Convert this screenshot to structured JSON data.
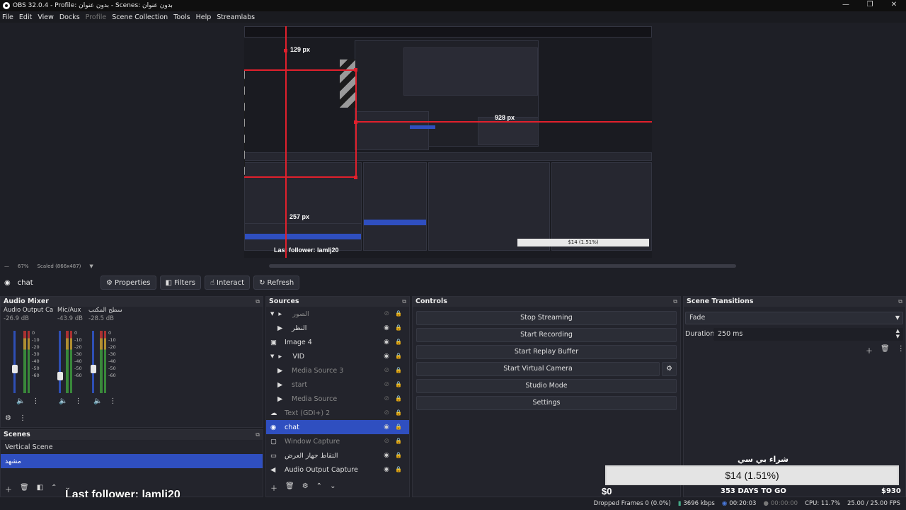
{
  "window": {
    "title": "OBS 32.0.4 - Profile: بدون عنوان - Scenes: بدون عنوان",
    "controls": [
      "—",
      "❐",
      "✕"
    ]
  },
  "menu": [
    "File",
    "Edit",
    "View",
    "Docks",
    "Profile",
    "Scene Collection",
    "Tools",
    "Help",
    "Streamlabs"
  ],
  "preview": {
    "zoom": "67%",
    "scaled": "Scaled (866x487)",
    "measurements": {
      "top": "129 px",
      "right": "928 px",
      "bottom": "257 px"
    },
    "nested_follower": "Last follower: lamlj20",
    "nested_goal": "$14 (1.51%)"
  },
  "source_toolbar": {
    "source_name": "chat",
    "properties": "Properties",
    "filters": "Filters",
    "interact": "Interact",
    "refresh": "Refresh"
  },
  "audio_mixer": {
    "title": "Audio Mixer",
    "channels": [
      {
        "name": "Audio Output Capt",
        "db": "-26.9 dB"
      },
      {
        "name": "Mic/Aux",
        "db": "-43.9 dB"
      },
      {
        "name": "صوت سطح المكتب",
        "db": "-28.5 dB"
      }
    ],
    "scale": [
      "0",
      "-5",
      "-10",
      "-15",
      "-20",
      "-25",
      "-30",
      "-35",
      "-40",
      "-45",
      "-50",
      "-55",
      "-60"
    ]
  },
  "scenes": {
    "title": "Scenes",
    "items": [
      "Vertical Scene",
      "مشهد"
    ]
  },
  "sources": {
    "title": "Sources",
    "items": [
      {
        "label": "الصور",
        "icon": "▸",
        "hidden": true
      },
      {
        "label": "النظر",
        "icon": "▶",
        "hidden": false
      },
      {
        "label": "Image 4",
        "icon": "▣",
        "hidden": false
      },
      {
        "label": "VID",
        "icon": "▸",
        "hidden": false
      },
      {
        "label": "Media Source 3",
        "icon": "▶",
        "hidden": true
      },
      {
        "label": "start",
        "icon": "▶",
        "hidden": true
      },
      {
        "label": "Media Source",
        "icon": "▶",
        "hidden": true
      },
      {
        "label": "Text (GDI+) 2",
        "icon": "☁",
        "hidden": true
      },
      {
        "label": "chat",
        "icon": "◉",
        "hidden": false
      },
      {
        "label": "Window Capture",
        "icon": "▢",
        "hidden": true
      },
      {
        "label": "التقاط جهاز العرض",
        "icon": "▭",
        "hidden": false
      },
      {
        "label": "Audio Output Capture",
        "icon": "◀",
        "hidden": false
      }
    ]
  },
  "controls": {
    "title": "Controls",
    "buttons": [
      "Stop Streaming",
      "Start Recording",
      "Start Replay Buffer",
      "Start Virtual Camera",
      "Studio Mode",
      "Settings"
    ]
  },
  "transitions": {
    "title": "Scene Transitions",
    "selected": "Fade",
    "duration_label": "Duration",
    "duration_value": "250 ms"
  },
  "overlay": {
    "follower": "Last follower: lamlj20",
    "goal_title": "شراء بي سي",
    "goal_amount": "$14 (1.51%)",
    "goal_progress": 0.0151,
    "goal_min": "$0",
    "goal_max": "$930",
    "goal_days": "353 DAYS TO GO"
  },
  "status": {
    "dropped": "Dropped Frames 0 (0.0%)",
    "bitrate": "3696 kbps",
    "stream_time": "00:20:03",
    "rec_time": "00:00:00",
    "cpu": "CPU: 11.7%",
    "fps": "25.00 / 25.00 FPS"
  },
  "colors": {
    "accent": "#2f4fc0",
    "guide": "#e0202c",
    "bg": "#1e1f26"
  }
}
